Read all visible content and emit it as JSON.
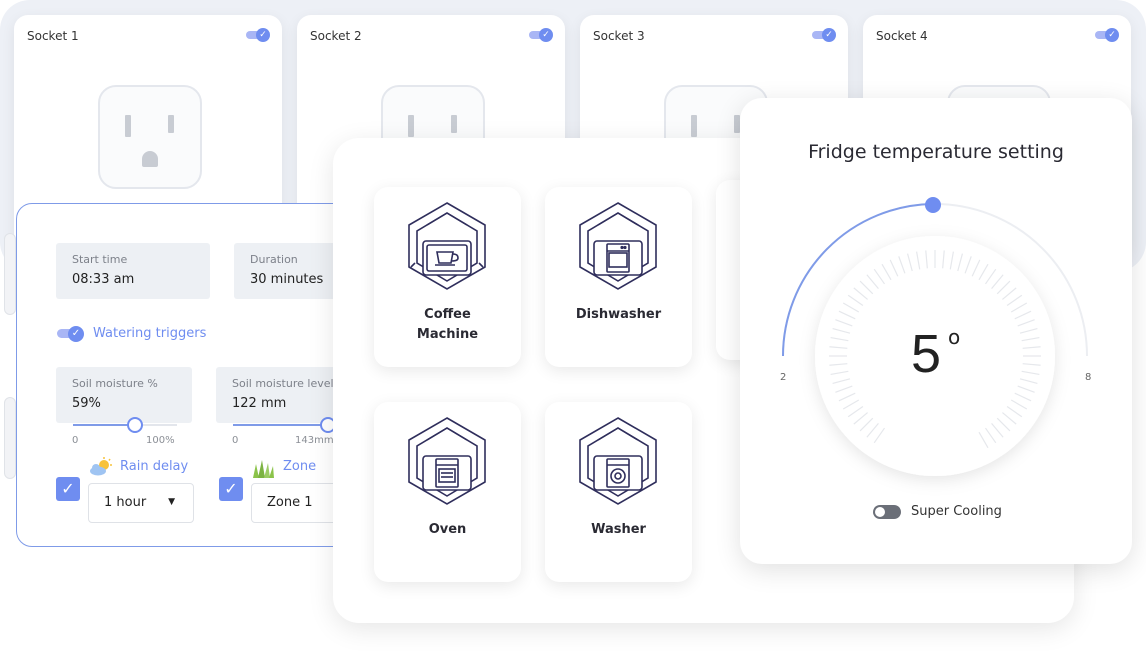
{
  "sockets": [
    {
      "label": "Socket 1",
      "enabled": true
    },
    {
      "label": "Socket 2",
      "enabled": true
    },
    {
      "label": "Socket 3",
      "enabled": true
    },
    {
      "label": "Socket 4",
      "enabled": true
    }
  ],
  "watering": {
    "start_time": {
      "label": "Start time",
      "value": "08:33 am"
    },
    "duration": {
      "label": "Duration",
      "value": "30 minutes"
    },
    "triggers": {
      "label": "Watering triggers",
      "enabled": true
    },
    "soil_moisture_pct": {
      "label": "Soil moisture %",
      "value": "59%",
      "min": "0",
      "max": "100%",
      "fraction": 0.59
    },
    "soil_moisture_level": {
      "label": "Soil moisture level",
      "value": "122 mm",
      "min": "0",
      "max": "143mm",
      "fraction": 0.85
    },
    "rain_delay": {
      "label": "Rain delay",
      "checked": true,
      "selected": "1 hour"
    },
    "zone": {
      "label": "Zone",
      "checked": true,
      "selected": "Zone 1"
    }
  },
  "appliances": [
    {
      "name_line1": "Coffee",
      "name_line2": "Machine",
      "icon": "coffee-machine-icon"
    },
    {
      "name_line1": "Dishwasher",
      "name_line2": "",
      "icon": "dishwasher-icon"
    },
    {
      "name_line1": "Oven",
      "name_line2": "",
      "icon": "oven-icon"
    },
    {
      "name_line1": "Washer",
      "name_line2": "",
      "icon": "washer-icon"
    }
  ],
  "fridge": {
    "title": "Fridge temperature setting",
    "value": "5",
    "unit": "o",
    "min": "2",
    "max": "8",
    "super_cooling_label": "Super Cooling",
    "super_cooling": false
  },
  "colors": {
    "accent": "#6f8df0",
    "text_dark": "#2a2a33",
    "icon_navy": "#2f2e5c"
  }
}
